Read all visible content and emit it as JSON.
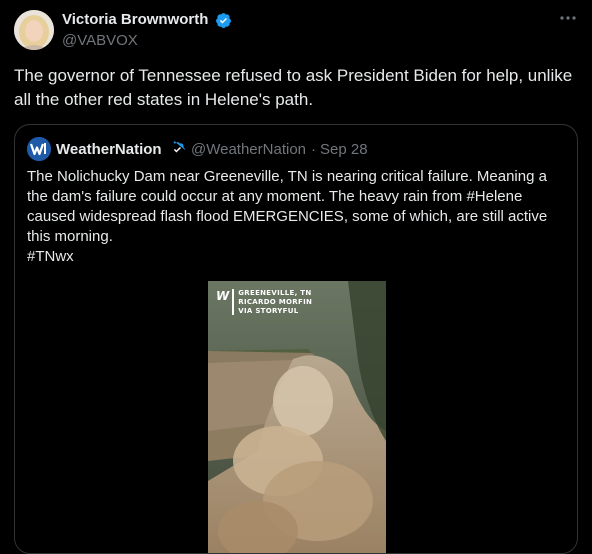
{
  "tweet": {
    "author_name": "Victoria Brownworth",
    "author_handle": "@VABVOX",
    "text": "The governor of Tennessee refused to ask President Biden for help, unlike all the other red states in Helene's path."
  },
  "quoted_tweet": {
    "author_name": "WeatherNation",
    "author_handle": "@WeatherNation",
    "separator": "·",
    "date": "Sep 28",
    "text": "The Nolichucky Dam near Greeneville, TN is nearing critical failure. Meaning a the dam's failure could occur at any moment. The heavy rain from #Helene caused widespread flash flood EMERGENCIES, some of which, are still active this morning.",
    "hashtag": "#TNwx",
    "media": {
      "watermark_logo": "W",
      "watermark_lines": [
        "GREENEVILLE, TN",
        "RICARDO MORFIN",
        "VIA STORYFUL"
      ]
    }
  },
  "icons": {
    "verified": "verified-badge-icon",
    "more": "more-horizontal-icon",
    "accent": "#1d9bf0"
  }
}
